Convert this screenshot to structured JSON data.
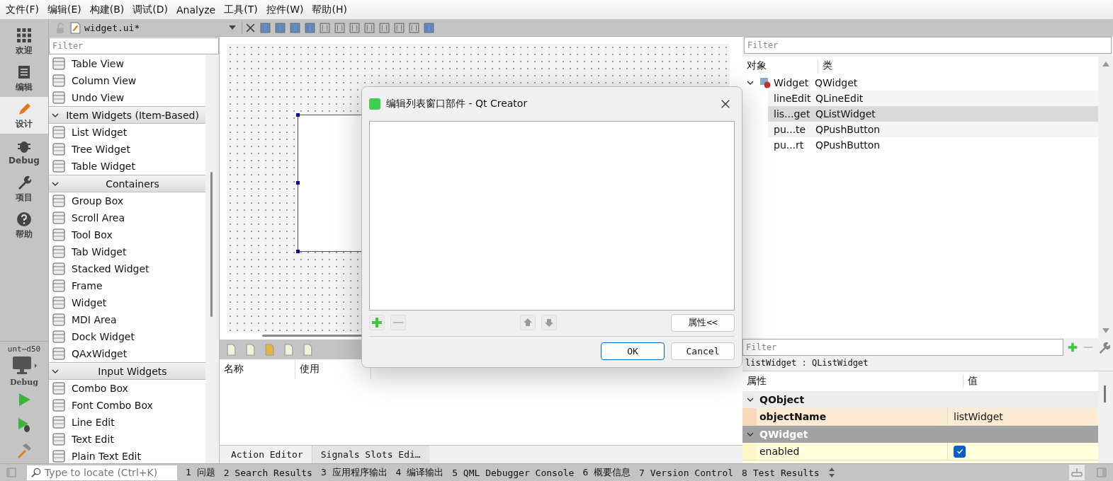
{
  "menu": [
    "文件(F)",
    "编辑(E)",
    "构建(B)",
    "调试(D)",
    "Analyze",
    "工具(T)",
    "控件(W)",
    "帮助(H)"
  ],
  "mode_bar": {
    "modes": [
      {
        "kind": "welcome",
        "label": "欢迎",
        "selected": false
      },
      {
        "kind": "edit",
        "label": "编辑",
        "selected": false
      },
      {
        "kind": "design",
        "label": "设计",
        "selected": true
      },
      {
        "kind": "debug",
        "label": "Debug",
        "selected": false
      },
      {
        "kind": "projects",
        "label": "项目",
        "selected": false
      },
      {
        "kind": "help",
        "label": "帮助",
        "selected": false
      }
    ],
    "kit": {
      "project": "unt⋯d50",
      "build": "Debug"
    }
  },
  "editor_toolbar": {
    "file": "widget.ui*"
  },
  "widget_box": {
    "filter_placeholder": "Filter",
    "sections": [
      {
        "items": [
          "Table View",
          "Column View",
          "Undo View"
        ]
      },
      {
        "title": "Item Widgets (Item-Based)",
        "expanded": true,
        "items": [
          "List Widget",
          "Tree Widget",
          "Table Widget"
        ]
      },
      {
        "title": "Containers",
        "expanded": true,
        "items": [
          "Group Box",
          "Scroll Area",
          "Tool Box",
          "Tab Widget",
          "Stacked Widget",
          "Frame",
          "Widget",
          "MDI Area",
          "Dock Widget",
          "QAxWidget"
        ]
      },
      {
        "title": "Input Widgets",
        "expanded": true,
        "items": [
          "Combo Box",
          "Font Combo Box",
          "Line Edit",
          "Text Edit",
          "Plain Text Edit"
        ]
      }
    ]
  },
  "dialog": {
    "title": "编辑列表窗口部件 - Qt Creator",
    "properties_button": "属性<<",
    "ok": "OK",
    "cancel": "Cancel"
  },
  "action_editor": {
    "columns": [
      "名称",
      "使用"
    ],
    "tabs": [
      {
        "label": "Action Editor",
        "selected": true
      },
      {
        "label": "Signals  Slots Edi…",
        "selected": false
      }
    ]
  },
  "object_inspector": {
    "filter_placeholder": "Filter",
    "columns": [
      "对象",
      "类"
    ],
    "tree": [
      {
        "name": "Widget",
        "class": "QWidget",
        "expanded": true,
        "selected": false,
        "children": [
          {
            "name": "lineEdit",
            "class": "QLineEdit",
            "selected": false
          },
          {
            "name": "lis...get",
            "class": "QListWidget",
            "selected": true
          },
          {
            "name": "pu...te",
            "class": "QPushButton",
            "selected": false
          },
          {
            "name": "pu...rt",
            "class": "QPushButton",
            "selected": false
          }
        ]
      }
    ]
  },
  "property_editor": {
    "filter_placeholder": "Filter",
    "object": "listWidget : QListWidget",
    "columns": [
      "属性",
      "值"
    ],
    "groups": [
      {
        "name": "QObject",
        "expanded": true,
        "properties": [
          {
            "kind": "text",
            "name": "objectName",
            "modified": true,
            "value": "listWidget"
          }
        ]
      },
      {
        "name": "QWidget",
        "expanded": true,
        "properties": [
          {
            "kind": "checkbox",
            "name": "enabled",
            "modified": false,
            "checked": true
          }
        ]
      }
    ]
  },
  "status_bar": {
    "locate_placeholder": "Type to locate (Ctrl+K)",
    "panes": [
      "1 问题",
      "2 Search Results",
      "3 应用程序输出",
      "4 编译输出",
      "5 QML Debugger Console",
      "6 概要信息",
      "7 Version Control",
      "8 Test Results"
    ]
  }
}
